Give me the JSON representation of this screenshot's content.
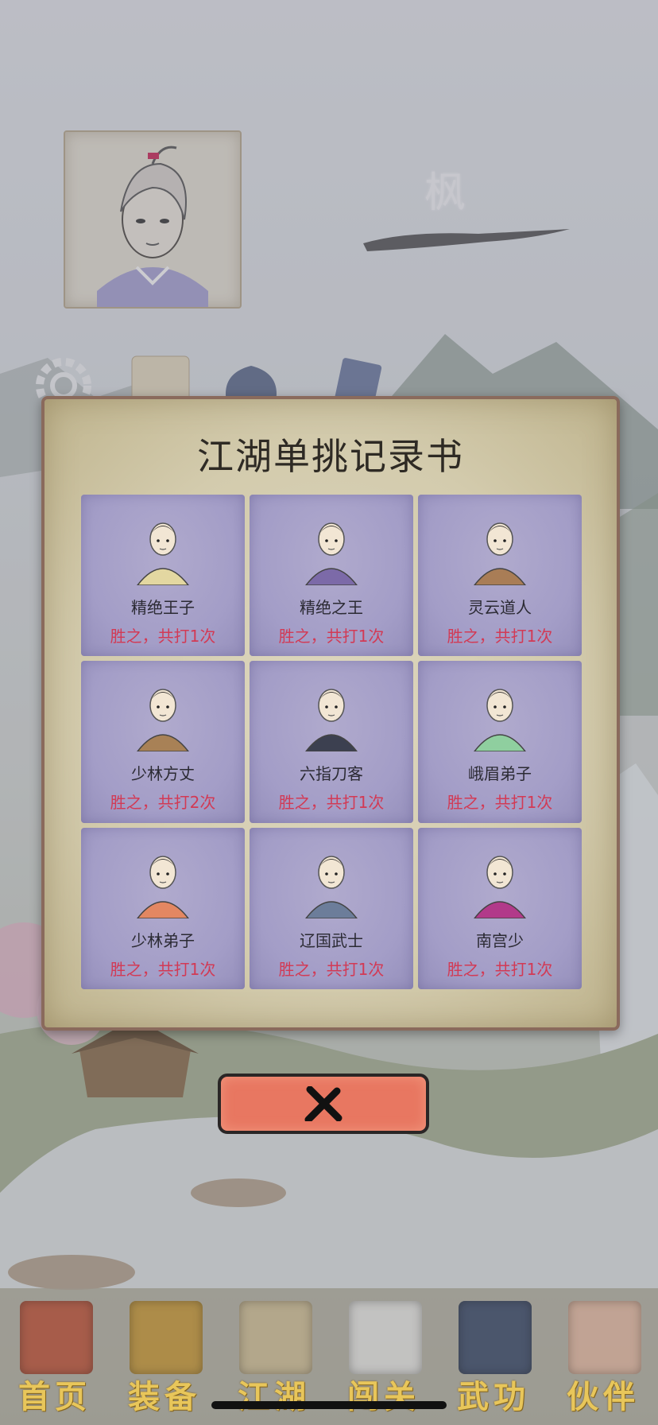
{
  "player": {
    "name": "枫"
  },
  "modal": {
    "title": "江湖单挑记录书",
    "opponents": [
      {
        "name": "精绝王子",
        "record": "胜之，共打1次",
        "icon": "prince-portrait-icon",
        "robe": "#e3d7a1"
      },
      {
        "name": "精绝之王",
        "record": "胜之，共打1次",
        "icon": "king-portrait-icon",
        "robe": "#7c6aa8"
      },
      {
        "name": "灵云道人",
        "record": "胜之，共打1次",
        "icon": "taoist-portrait-icon",
        "robe": "#a97d56"
      },
      {
        "name": "少林方丈",
        "record": "胜之，共打2次",
        "icon": "abbot-portrait-icon",
        "robe": "#a88156"
      },
      {
        "name": "六指刀客",
        "record": "胜之，共打1次",
        "icon": "swordsman-portrait-icon",
        "robe": "#3c4050"
      },
      {
        "name": "峨眉弟子",
        "record": "胜之，共打1次",
        "icon": "emei-disciple-portrait-icon",
        "robe": "#8fcf9f"
      },
      {
        "name": "少林弟子",
        "record": "胜之，共打1次",
        "icon": "shaolin-disciple-portrait-icon",
        "robe": "#e38762"
      },
      {
        "name": "辽国武士",
        "record": "胜之，共打1次",
        "icon": "liao-warrior-portrait-icon",
        "robe": "#6c7d9a"
      },
      {
        "name": "南宫少",
        "record": "胜之，共打1次",
        "icon": "nangong-portrait-icon",
        "robe": "#b23a8a"
      }
    ]
  },
  "nav": [
    {
      "label": "首页",
      "icon": "home-hall-icon"
    },
    {
      "label": "装备",
      "icon": "armor-icon"
    },
    {
      "label": "江湖",
      "icon": "scroll-map-icon"
    },
    {
      "label": "闯关",
      "icon": "crossed-swords-icon"
    },
    {
      "label": "武功",
      "icon": "martial-book-icon"
    },
    {
      "label": "伙伴",
      "icon": "partners-icon"
    }
  ],
  "colors": {
    "record": "#d23a55",
    "close_button": "#e87761",
    "cell": "#a39dc7",
    "nav_label": "#e8c65a"
  }
}
